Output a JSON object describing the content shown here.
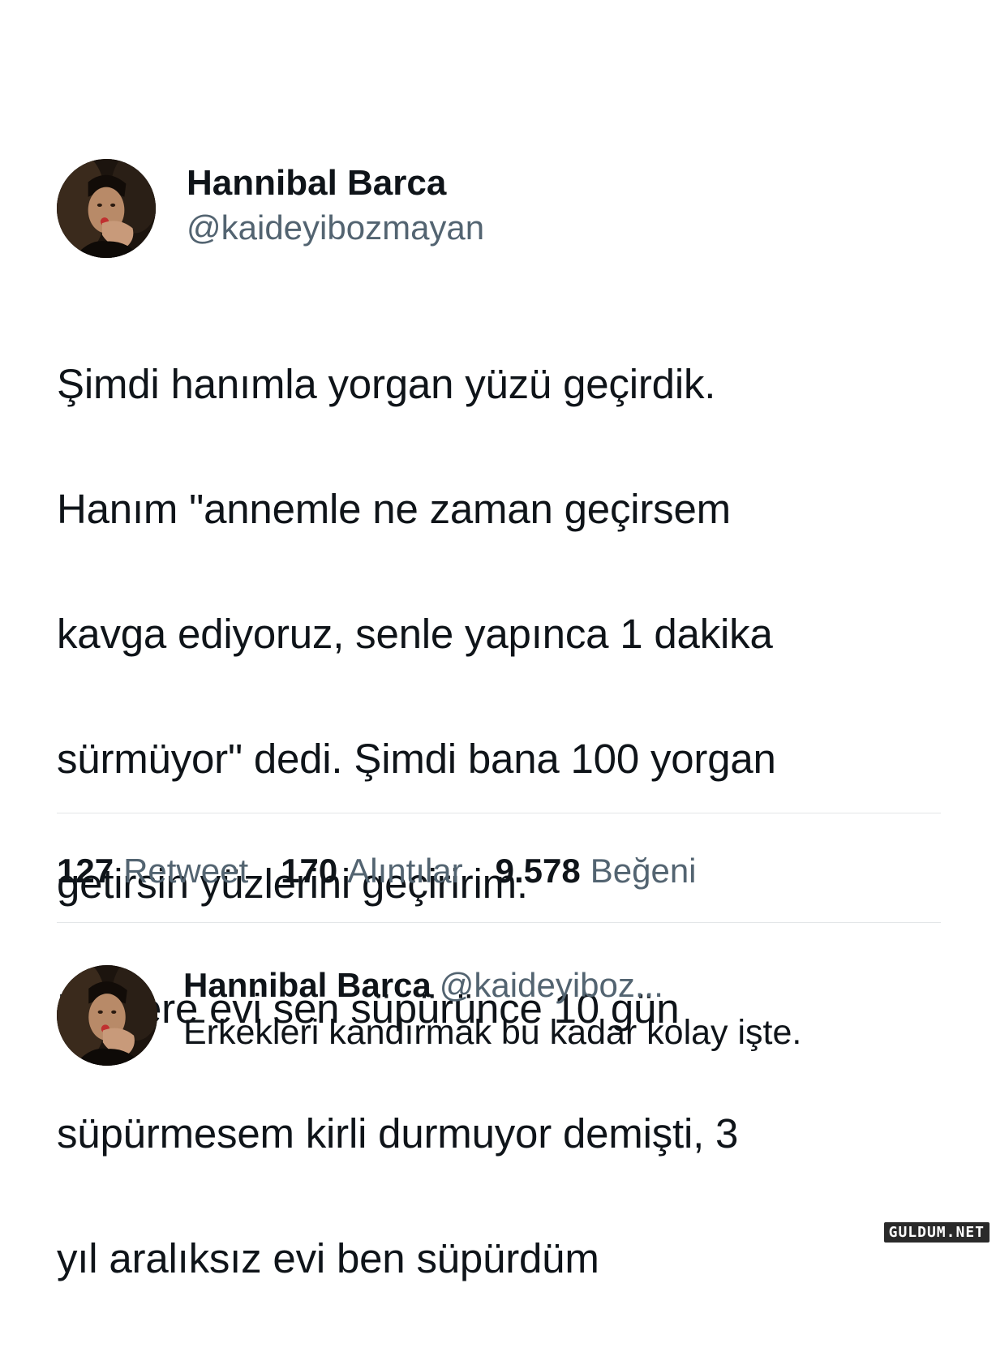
{
  "tweet": {
    "display_name": "Hannibal Barca",
    "handle": "@kaideyibozmayan",
    "avatar_icon": "user-photo-avatar",
    "text_lines": [
      "Şimdi hanımla yorgan yüzü geçirdik.",
      "Hanım \"annemle ne zaman geçirsem",
      "kavga ediyoruz, senle yapınca 1 dakika",
      "sürmüyor\" dedi. Şimdi bana 100 yorgan",
      "getirsin yüzlerini geçiririm.",
      "Bir kere evi sen süpürünce 10 gün",
      "süpürmesem kirli durmuyor demişti, 3",
      "yıl aralıksız evi ben süpürdüm"
    ]
  },
  "stats": {
    "retweets_count": "127",
    "retweets_label": "Retweet",
    "quotes_count": "170",
    "quotes_label": "Alıntılar",
    "likes_count": "9.578",
    "likes_label": "Beğeni"
  },
  "reply": {
    "display_name": "Hannibal Barca",
    "handle": "@kaideyiboz...",
    "text": "Erkekleri kandırmak bu kadar kolay işte.",
    "avatar_icon": "user-photo-avatar"
  },
  "watermark": "GULDUM.NET",
  "colors": {
    "primary_text": "#0f1419",
    "secondary_text": "#536471",
    "divider": "#e3e6e8",
    "background": "#ffffff"
  }
}
